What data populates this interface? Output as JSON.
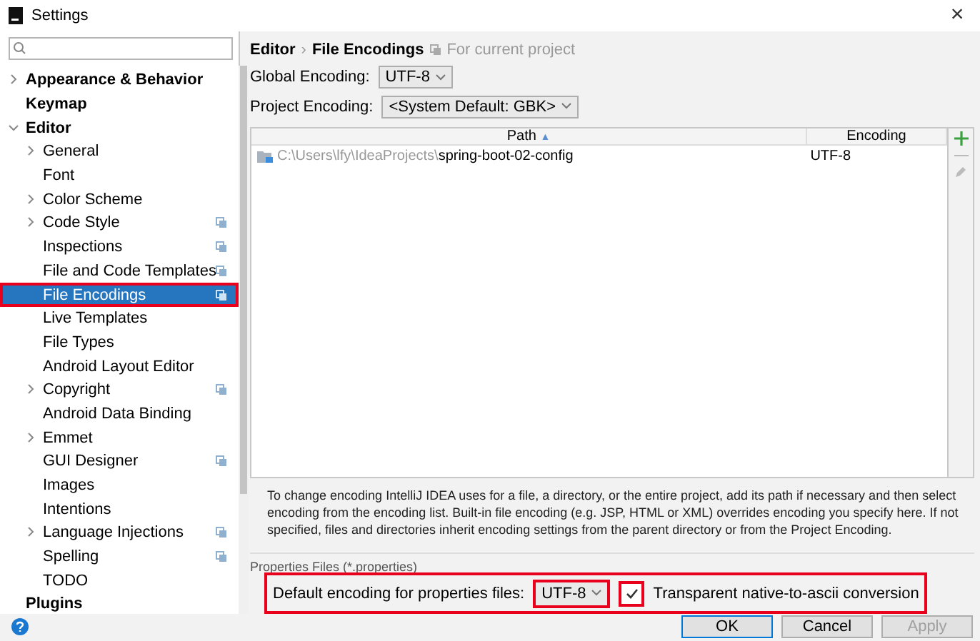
{
  "window": {
    "title": "Settings",
    "close": "×"
  },
  "sidebar": {
    "items": [
      {
        "label": "Appearance & Behavior",
        "bold": true,
        "expanded": false,
        "selected": false
      },
      {
        "label": "Keymap",
        "bold": true,
        "selected": false
      },
      {
        "label": "Editor",
        "bold": true,
        "expanded": true,
        "selected": false,
        "children": [
          {
            "label": "General",
            "expanded": false,
            "selected": false
          },
          {
            "label": "Font",
            "selected": false
          },
          {
            "label": "Color Scheme",
            "expanded": false,
            "selected": false
          },
          {
            "label": "Code Style",
            "expanded": false,
            "selected": false,
            "project": true
          },
          {
            "label": "Inspections",
            "selected": false,
            "project": true
          },
          {
            "label": "File and Code Templates",
            "selected": false,
            "project": true
          },
          {
            "label": "File Encodings",
            "selected": true,
            "project": true,
            "highlighted": true
          },
          {
            "label": "Live Templates",
            "selected": false
          },
          {
            "label": "File Types",
            "selected": false
          },
          {
            "label": "Android Layout Editor",
            "selected": false
          },
          {
            "label": "Copyright",
            "expanded": false,
            "selected": false,
            "project": true
          },
          {
            "label": "Android Data Binding",
            "selected": false
          },
          {
            "label": "Emmet",
            "expanded": false,
            "selected": false
          },
          {
            "label": "GUI Designer",
            "selected": false,
            "project": true
          },
          {
            "label": "Images",
            "selected": false
          },
          {
            "label": "Intentions",
            "selected": false
          },
          {
            "label": "Language Injections",
            "expanded": false,
            "selected": false,
            "project": true
          },
          {
            "label": "Spelling",
            "selected": false,
            "project": true
          },
          {
            "label": "TODO",
            "selected": false
          }
        ]
      },
      {
        "label": "Plugins",
        "bold": true,
        "selected": false
      }
    ]
  },
  "breadcrumb": {
    "parent": "Editor",
    "separator": "›",
    "current": "File Encodings",
    "scope": "For current project"
  },
  "global_encoding": {
    "label": "Global Encoding:",
    "value": "UTF-8"
  },
  "project_encoding": {
    "label": "Project Encoding:",
    "value": "<System Default: GBK>"
  },
  "table": {
    "columns": [
      {
        "label": "Path",
        "sort": "▲"
      },
      {
        "label": "Encoding"
      }
    ],
    "rows": [
      {
        "path_prefix": "C:\\Users\\lfy\\IdeaProjects\\",
        "path_name": "spring-boot-02-config",
        "encoding": "UTF-8"
      }
    ]
  },
  "description": "To change encoding IntelliJ IDEA uses for a file, a directory, or the entire project, add its path if necessary and then select encoding from the encoding list. Built-in file encoding (e.g. JSP, HTML or XML) overrides encoding you specify here. If not specified, files and directories inherit encoding settings from the parent directory or from the Project Encoding.",
  "properties": {
    "title": "Properties Files (*.properties)",
    "highlighted": true,
    "label": "Default encoding for properties files:",
    "value": "UTF-8",
    "value_highlighted": true,
    "checkbox": {
      "label": "Transparent native-to-ascii conversion",
      "checked": true,
      "highlighted": true
    }
  },
  "buttons": [
    {
      "label": "OK",
      "default": true,
      "disabled": false
    },
    {
      "label": "Cancel",
      "default": false,
      "disabled": false
    },
    {
      "label": "Apply",
      "default": false,
      "disabled": true
    }
  ]
}
